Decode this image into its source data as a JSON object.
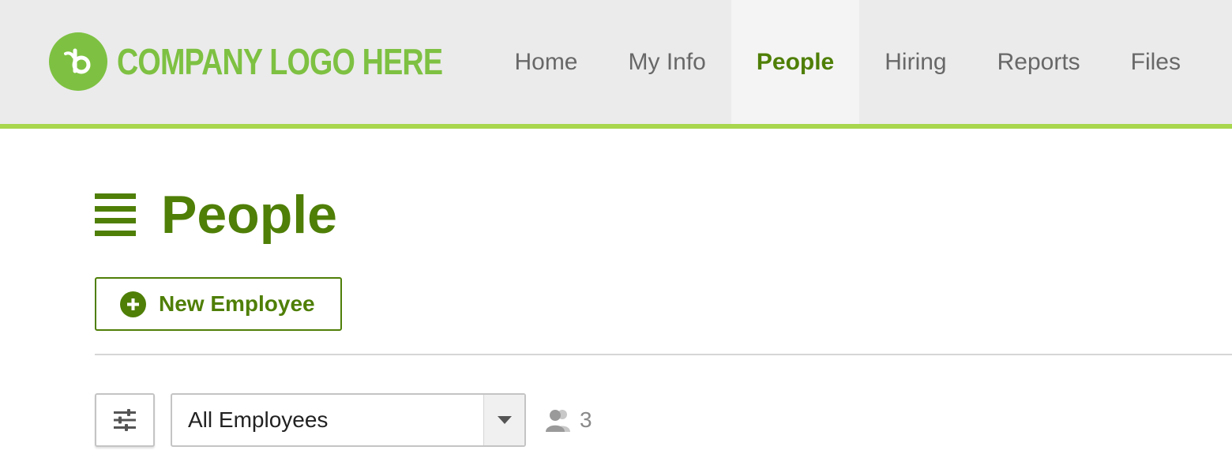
{
  "header": {
    "logo_text": "COMPANY LOGO HERE",
    "logo_icon": "bamboo-b-logo-icon",
    "nav": [
      {
        "label": "Home",
        "active": false
      },
      {
        "label": "My Info",
        "active": false
      },
      {
        "label": "People",
        "active": true
      },
      {
        "label": "Hiring",
        "active": false
      },
      {
        "label": "Reports",
        "active": false
      },
      {
        "label": "Files",
        "active": false
      }
    ]
  },
  "page": {
    "title": "People",
    "menu_icon": "hamburger-menu-icon",
    "new_employee_button": {
      "label": "New Employee",
      "icon": "plus-circle-icon"
    }
  },
  "toolbar": {
    "filter_icon": "sliders-icon",
    "employee_filter": {
      "selected": "All Employees"
    },
    "employee_count": "3",
    "count_icon": "people-icon"
  },
  "colors": {
    "brand_green": "#4f7f07",
    "logo_green": "#7ec142",
    "accent_line": "#a8d64d",
    "header_bg": "#ebebeb"
  }
}
